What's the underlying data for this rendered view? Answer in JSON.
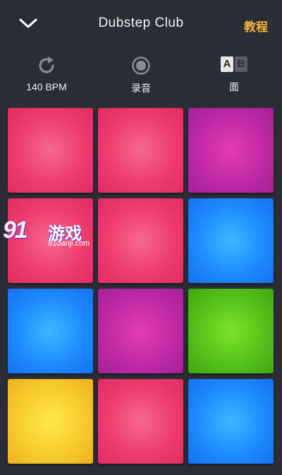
{
  "header": {
    "title": "Dubstep Club",
    "tutorial_label": "教程",
    "back_icon": "chevron-down-icon"
  },
  "toolbar": {
    "bpm_label": "140 BPM",
    "record_label": "录音",
    "ab_label": "面",
    "ab_a": "A",
    "ab_b": "B"
  },
  "pads": [
    {
      "color": "pink"
    },
    {
      "color": "pink"
    },
    {
      "color": "purple"
    },
    {
      "color": "pink"
    },
    {
      "color": "pink"
    },
    {
      "color": "blue"
    },
    {
      "color": "blue"
    },
    {
      "color": "purple"
    },
    {
      "color": "green"
    },
    {
      "color": "yellow"
    },
    {
      "color": "pink"
    },
    {
      "color": "blue"
    }
  ],
  "colors": {
    "background": "#2b2d36",
    "accent": "#f2b53a",
    "pink": "#ee3d6e",
    "purple": "#c02aa4",
    "blue": "#1e8cff",
    "green": "#55c21a",
    "yellow": "#f7cc2e"
  },
  "watermark": {
    "logo": "91",
    "text": "游戏",
    "url": "91danji.com"
  }
}
